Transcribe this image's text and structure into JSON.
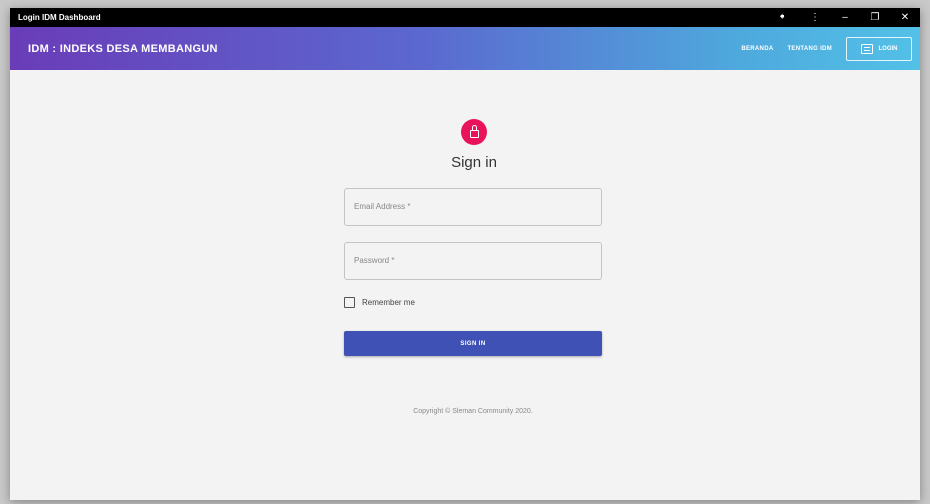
{
  "window": {
    "title": "Login IDM Dashboard",
    "controls": {
      "back": "🠸",
      "more": "⋮",
      "minimize": "–",
      "maximize": "❐",
      "close": "✕"
    }
  },
  "appbar": {
    "brand": "IDM : INDEKS DESA MEMBANGUN",
    "nav": {
      "beranda": "BERANDA",
      "tentang": "TENTANG IDM",
      "login": "LOGIN"
    }
  },
  "form": {
    "heading": "Sign in",
    "email_placeholder": "Email Address *",
    "password_placeholder": "Password *",
    "remember_label": "Remember me",
    "submit_label": "SIGN IN"
  },
  "footer": {
    "copyright": "Copyright © Sleman Community 2020."
  },
  "colors": {
    "accent": "#3f51b5",
    "avatar": "#e9135b",
    "gradient_start": "#6a3cb8",
    "gradient_end": "#52c1e7"
  }
}
